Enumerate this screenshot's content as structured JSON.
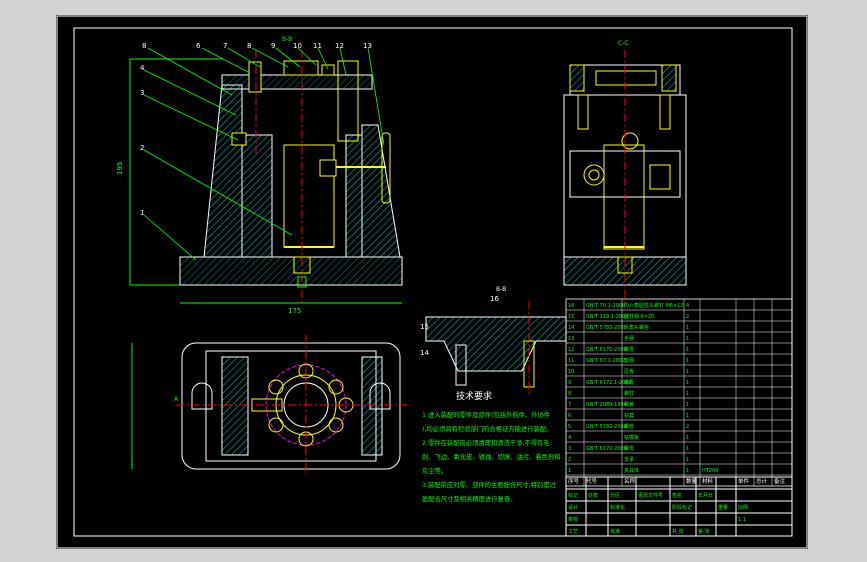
{
  "part_numbers_main": [
    "8",
    "6",
    "7",
    "8",
    "9",
    "10",
    "11",
    "12",
    "13"
  ],
  "part_numbers_left": [
    "4",
    "3",
    "2",
    "1"
  ],
  "section_label_top": "B-B",
  "side_view_label": "C-C",
  "detail_label": "B-B",
  "detail_part_15": "15",
  "detail_part_14": "14",
  "detail_part_16": "16",
  "dim_height": "195",
  "dim_width": "175",
  "dim_plan": "A",
  "tech_req_title": "技术要求",
  "tech_req_lines": [
    "1.进入装配的零件及部件(包括外购件、外协件",
    "),均必须具有检验部门的合格证方能进行装配。",
    "2.零件在装配前必须清理和清洗干净,不得有毛",
    "刺、飞边、氧化皮、锈蚀、切屑、油污、着色剂和",
    "灰尘等。",
    "3.装配前应对零、部件的主要配合尺寸,特别是过",
    "盈配合尺寸及相关精度进行复查。"
  ],
  "bom_header": [
    "序号",
    "代号",
    "名称",
    "数量",
    "材料",
    "单件",
    "总计",
    "备注"
  ],
  "bom_rows": [
    [
      "16",
      "GB/T 70.1-2008",
      "内六角圆柱头螺钉 M6×12",
      "4",
      "",
      "",
      "",
      ""
    ],
    [
      "15",
      "GB/T 119.1-2000",
      "圆柱销 6×20",
      "2",
      "",
      "",
      "",
      ""
    ],
    [
      "14",
      "GB/T 5783-2000",
      "六角头螺栓",
      "1",
      "",
      "",
      "",
      ""
    ],
    [
      "13",
      "",
      "手柄",
      "1",
      "",
      "",
      "",
      ""
    ],
    [
      "12",
      "GB/T 6170-2000",
      "螺母",
      "1",
      "",
      "",
      "",
      ""
    ],
    [
      "11",
      "GB/T 97.1-2002",
      "垫圈",
      "1",
      "",
      "",
      "",
      ""
    ],
    [
      "10",
      "",
      "压板",
      "1",
      "",
      "",
      "",
      ""
    ],
    [
      "9",
      "GB/T 6172.1-2000",
      "螺母",
      "1",
      "",
      "",
      "",
      ""
    ],
    [
      "8",
      "",
      "螺柱",
      "1",
      "",
      "",
      "",
      ""
    ],
    [
      "7",
      "GB/T 2089-1994",
      "弹簧",
      "1",
      "",
      "",
      "",
      ""
    ],
    [
      "6",
      "",
      "钻套",
      "1",
      "",
      "",
      "",
      ""
    ],
    [
      "5",
      "GB/T 5782-2000",
      "螺栓",
      "2",
      "",
      "",
      "",
      ""
    ],
    [
      "4",
      "",
      "钻模板",
      "1",
      "",
      "",
      "",
      ""
    ],
    [
      "3",
      "GB/T 6170-2000",
      "螺母",
      "1",
      "",
      "",
      "",
      ""
    ],
    [
      "2",
      "",
      "支承",
      "1",
      "",
      "",
      "",
      ""
    ],
    [
      "1",
      "",
      "夹具体",
      "1",
      "HT200",
      "",
      "",
      ""
    ]
  ],
  "title_block": [
    "标记",
    "处数",
    "分区",
    "更改文件号",
    "签名",
    "年月日",
    "设计",
    "标准化",
    "阶段标记",
    "重量",
    "比例",
    "审核",
    "工艺",
    "批准",
    "共 张",
    "第 张",
    "1:1"
  ],
  "colors": {
    "sheet_bg": "#000000",
    "outline": "#ffffff",
    "part": "#ffff00",
    "dim": "#00ff00",
    "center": "#ff0000",
    "hatch": "#00ffff",
    "hidden": "#ff00ff"
  }
}
